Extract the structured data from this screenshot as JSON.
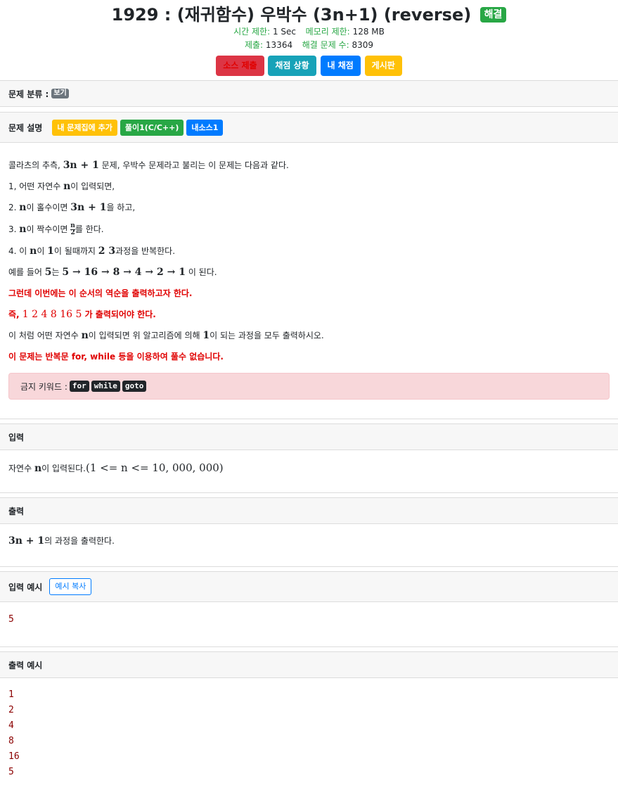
{
  "problem": {
    "title": "1929 : (재귀함수) 우박수 (3n+1) (reverse)",
    "solved_badge": "해결",
    "meta1": [
      {
        "label": "시간 제한:",
        "value": "1 Sec"
      },
      {
        "label": "메모리 제한:",
        "value": "128 MB"
      }
    ],
    "meta2": [
      {
        "label": "제출:",
        "value": "13364"
      },
      {
        "label": "해결 문제 수:",
        "value": "8309"
      }
    ],
    "buttons": [
      "소스 제출",
      "채점 상황",
      "내 채점",
      "게시판"
    ]
  },
  "category": {
    "label": "문제 분류 :",
    "badge": "보기"
  },
  "description": {
    "label": "문제 설명",
    "tags": [
      "내 문제집에 추가",
      "풀이1(C/C++)",
      "내소스1"
    ],
    "l1a": "콜라츠의 추측, ",
    "l1m": "3n + 1",
    "l1b": " 문제, 우박수 문제라고 불리는 이 문제는 다음과 같다.",
    "l2a": "1, 어떤 자연수 ",
    "l2m": "n",
    "l2b": "이 입력되면,",
    "l3a": "2. ",
    "l3m1": "n",
    "l3b": "이 홀수이면 ",
    "l3m2": "3n + 1",
    "l3c": "을 하고,",
    "l4a": "3. ",
    "l4m": "n",
    "l4b": "이 짝수이면 ",
    "l4num": "n",
    "l4den": "2",
    "l4c": "를 한다.",
    "l5a": "4. 이 ",
    "l5m1": "n",
    "l5b": "이 ",
    "l5m2": "1",
    "l5c": "이 될때까지 ",
    "l5m3": "2 3",
    "l5d": "과정을 반복한다.",
    "l6a": "예를 들어 ",
    "l6m1": "5",
    "l6b": "는 ",
    "l6m2": "5 → 16 → 8 → 4 → 2 → 1",
    "l6c": " 이 된다.",
    "l7": "그런데 이번에는 이 순서의 역순을 출력하고자 한다.",
    "l8a": "즉, ",
    "l8m": "1 2 4 8 16 5",
    "l8b": " 가 출력되어야 한다.",
    "l9a": "이 처럼 어떤 자연수 ",
    "l9m1": "n",
    "l9b": "이 입력되면 위 알고리즘에 의해 ",
    "l9m2": "1",
    "l9c": "이 되는 과정을 모두 출력하시오.",
    "l10": "이 문제는 반복문 for, while 등을 이용하여 풀수 없습니다.",
    "forbidden_label": "금지 키워드 :",
    "forbidden": [
      "for",
      "while",
      "goto"
    ]
  },
  "input": {
    "label": "입력",
    "a": "자연수 ",
    "m1": "n",
    "b": "이 입력된다.",
    "m2": "(1 <= n <= 10, 000, 000)"
  },
  "output": {
    "label": "출력",
    "m": "3n + 1",
    "a": "의 과정을 출력한다."
  },
  "sample_input": {
    "label": "입력 예시",
    "copy": "예시 복사",
    "lines": [
      "5"
    ]
  },
  "sample_output": {
    "label": "출력 예시",
    "lines": [
      "1",
      "2",
      "4",
      "8",
      "16",
      "5"
    ]
  },
  "colors": {
    "accent_green": "#28a745",
    "danger_red": "#dc3545",
    "info_teal": "#17a2b8",
    "primary_blue": "#007bff",
    "warning_yellow": "#ffc107",
    "emphasis_red": "#e00000"
  }
}
